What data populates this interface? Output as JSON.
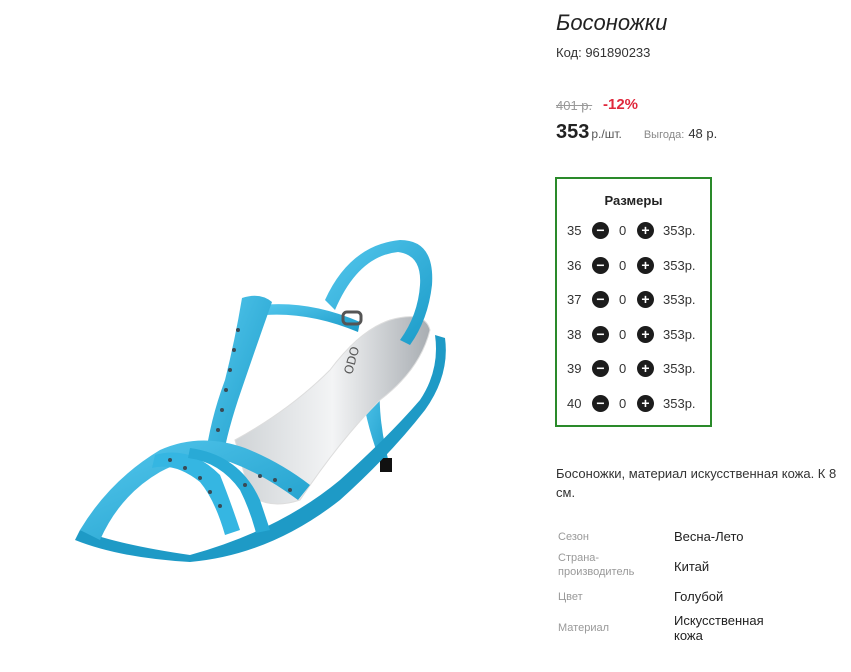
{
  "product": {
    "title": "Босоножки",
    "code": "Код: 961890233",
    "image_alt": "turquoise-high-heel-sandal",
    "insole_text": "ODO"
  },
  "pricing": {
    "old_price": "401 р.",
    "discount": "-12%",
    "price": "353",
    "unit": "р./шт.",
    "benefit_label": "Выгода:",
    "benefit_value": "48 р."
  },
  "sizes": {
    "title": "Размеры",
    "rows": [
      {
        "size": "35",
        "qty": "0",
        "price": "353р."
      },
      {
        "size": "36",
        "qty": "0",
        "price": "353р."
      },
      {
        "size": "37",
        "qty": "0",
        "price": "353р."
      },
      {
        "size": "38",
        "qty": "0",
        "price": "353р."
      },
      {
        "size": "39",
        "qty": "0",
        "price": "353р."
      },
      {
        "size": "40",
        "qty": "0",
        "price": "353р."
      }
    ],
    "minus_symbol": "−",
    "plus_symbol": "+"
  },
  "description": "Босоножки, материал искусственная кожа. К 8 см.",
  "attributes": [
    {
      "label": "Сезон",
      "value": "Весна-Лето"
    },
    {
      "label": "Страна-производитель",
      "value": "Китай"
    },
    {
      "label": "Цвет",
      "value": "Голубой"
    },
    {
      "label": "Материал",
      "value": "Искусственная кожа"
    }
  ],
  "colors": {
    "accent_border": "#2a8a2a",
    "discount": "#e0283c",
    "sandal": "#2db2dd"
  }
}
